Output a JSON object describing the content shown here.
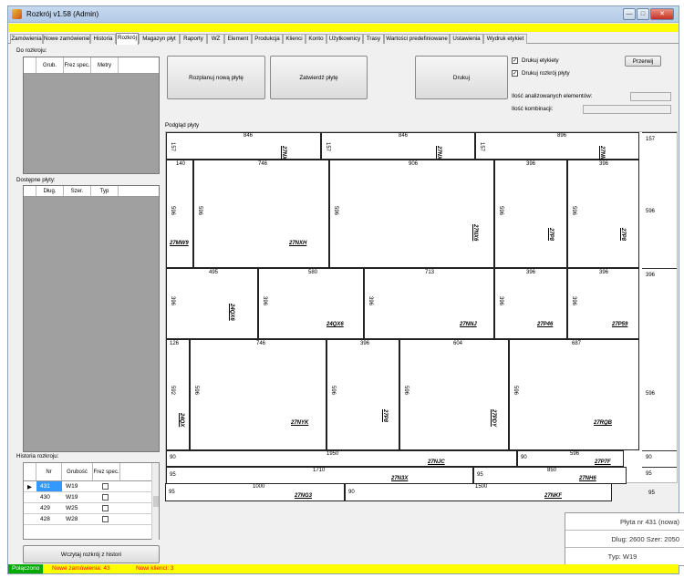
{
  "window": {
    "title": "Rozkrój v1.58 (Admin)",
    "minimize": "—",
    "maximize": "□",
    "close": "✕"
  },
  "tabs": [
    "Zamówienia",
    "Nowe zamówienie",
    "Historia",
    "Rozkrój",
    "Magazyn płyt",
    "Raporty",
    "WZ",
    "Element",
    "Produkcja",
    "Klienci",
    "Konto",
    "Użytkownicy",
    "Trasy",
    "Wartości predefiniowane",
    "Ustawienia",
    "Wydruk etykiet"
  ],
  "left": {
    "do_rozkroju": {
      "label": "Do rozkroju:",
      "columns": [
        "Grub.",
        "Frez spec.",
        "Metry"
      ]
    },
    "dostepne": {
      "label": "Dostępne płyty:",
      "columns": [
        "Dług.",
        "Szer.",
        "Typ"
      ]
    },
    "historia": {
      "label": "Historia rozkroju:",
      "columns": [
        "Nr",
        "Grubość",
        "Frez spec."
      ],
      "rows": [
        {
          "nr": "431",
          "grubosc": "W19",
          "selected": true
        },
        {
          "nr": "430",
          "grubosc": "W19"
        },
        {
          "nr": "429",
          "grubosc": "W25"
        },
        {
          "nr": "428",
          "grubosc": "W28"
        }
      ]
    },
    "wczytaj_btn": "Wczytaj rozkrój z histori"
  },
  "buttons": {
    "rozplanuj": "Rozplanuj nową płytę",
    "zatwierdz": "Zatwierdź płytę",
    "drukuj": "Drukuj",
    "przerwij": "Przerwij"
  },
  "options": {
    "drukuj_etykiety": "Drukuj etykiety",
    "drukuj_rozkroj": "Drukuj rozkrój płyty",
    "ilosc_analizowanych": "Ilość analizowanych elementów:",
    "ilosc_kombinacji": "Ilość kombinacji:"
  },
  "preview": {
    "label": "Podgląd płyty",
    "row_heights": [
      "157",
      "596",
      "396",
      "596",
      "90",
      "95",
      "95"
    ],
    "pieces": [
      {
        "id": "27NX62",
        "w": "846",
        "h": "157"
      },
      {
        "id": "27NX59",
        "w": "846",
        "h": "157"
      },
      {
        "id": "27NME",
        "w": "896",
        "h": "157"
      },
      {
        "id": "",
        "w": "140",
        "h": "596"
      },
      {
        "id": "27NXH",
        "w": "746",
        "h": "596"
      },
      {
        "id": "27NX6",
        "w": "906",
        "h": "596"
      },
      {
        "id": "27P8",
        "w": "396",
        "h": "596"
      },
      {
        "id": "27P8",
        "w": "396",
        "h": "596"
      },
      {
        "id": "24QX6",
        "w": "495",
        "h": "396"
      },
      {
        "id": "24QX6",
        "w": "580",
        "h": "396"
      },
      {
        "id": "27NNJ",
        "w": "713",
        "h": "396"
      },
      {
        "id": "27P46",
        "w": "396",
        "h": "396"
      },
      {
        "id": "27P59",
        "w": "396",
        "h": "396"
      },
      {
        "id": "24QX",
        "w": "126",
        "h": "592"
      },
      {
        "id": "27NYK",
        "w": "746",
        "h": "596"
      },
      {
        "id": "27P8",
        "w": "396",
        "h": "596"
      },
      {
        "id": "27PDY",
        "w": "604",
        "h": "596"
      },
      {
        "id": "27RQB",
        "w": "687",
        "h": "596"
      },
      {
        "id": "27NJC",
        "w": "1950",
        "h": "90"
      },
      {
        "id": "27P7F",
        "w": "596",
        "h": "90"
      },
      {
        "id": "27N3X",
        "w": "1710",
        "h": "95"
      },
      {
        "id": "27NH6",
        "w": "850",
        "h": "95"
      },
      {
        "id": "27NG3",
        "w": "1000",
        "h": "95"
      },
      {
        "id": "27NKF",
        "w": "1500",
        "h": "90"
      }
    ],
    "mw9": "27MW9"
  },
  "info": {
    "plyta": "Płyta nr 431 (nowa)",
    "dlug": "Dlug: 2600 Szer: 2050",
    "typ": "Typ: W19"
  },
  "status": {
    "connected": "Połączono",
    "orders": "Nowe zamówienia: 43",
    "clients": "Nowi klienci: 3"
  },
  "colors": {
    "yellow": "#ffff00",
    "status_green": "#00aa00",
    "status_red": "#ff0000"
  }
}
